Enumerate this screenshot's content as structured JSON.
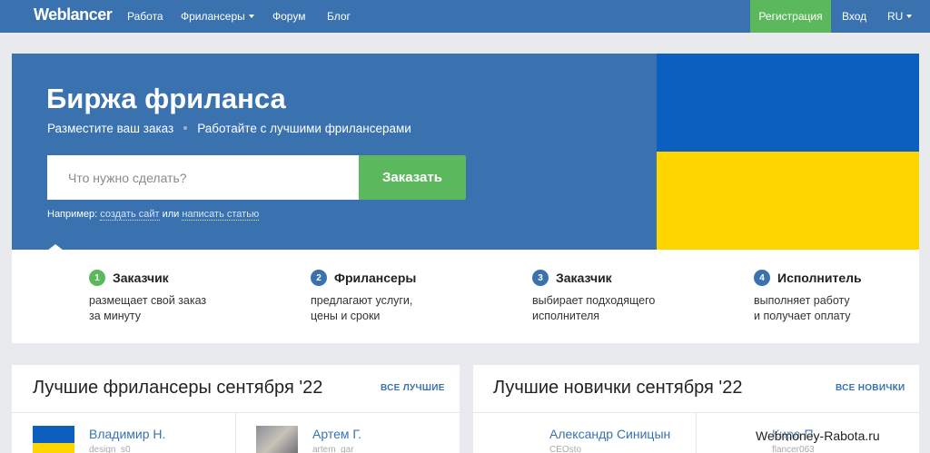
{
  "nav": {
    "logo": "Weblancer",
    "work": "Работа",
    "freelancers": "Фрилансеры",
    "forum": "Форум",
    "blog": "Блог",
    "register": "Регистрация",
    "login": "Вход",
    "lang": "RU"
  },
  "hero": {
    "title": "Биржа фриланса",
    "sub_left": "Разместите ваш заказ",
    "sub_right": "Работайте с лучшими фрилансерами",
    "search_placeholder": "Что нужно сделать?",
    "order_button": "Заказать",
    "example_label": "Например:",
    "example_link1": "создать сайт",
    "example_or": "или",
    "example_link2": "написать статью"
  },
  "steps": [
    {
      "num": "1",
      "title": "Заказчик",
      "line1": "размещает свой заказ",
      "line2": "за минуту"
    },
    {
      "num": "2",
      "title": "Фрилансеры",
      "line1": "предлагают услуги,",
      "line2": "цены и сроки"
    },
    {
      "num": "3",
      "title": "Заказчик",
      "line1": "выбирает подходящего",
      "line2": "исполнителя"
    },
    {
      "num": "4",
      "title": "Исполнитель",
      "line1": "выполняет работу",
      "line2": "и получает оплату"
    }
  ],
  "best": {
    "title": "Лучшие фрилансеры сентября '22",
    "link": "ВСЕ ЛУЧШИЕ",
    "people": [
      {
        "name": "Владимир Н.",
        "sub": "design_s0"
      },
      {
        "name": "Артем Г.",
        "sub": "artem_gar"
      }
    ]
  },
  "newbies": {
    "title": "Лучшие новички сентября '22",
    "link": "ВСЕ НОВИЧКИ",
    "people": [
      {
        "name": "Александр Синицын",
        "sub": "CEOsto"
      },
      {
        "name": "Кира П.",
        "sub": "flancer063"
      }
    ]
  },
  "watermark": "Webmoney-Rabota.ru",
  "colors": {
    "primary": "#3a72b0",
    "accent": "#5cb85c",
    "flag_blue": "#0c5fbf",
    "flag_yellow": "#ffd500"
  }
}
